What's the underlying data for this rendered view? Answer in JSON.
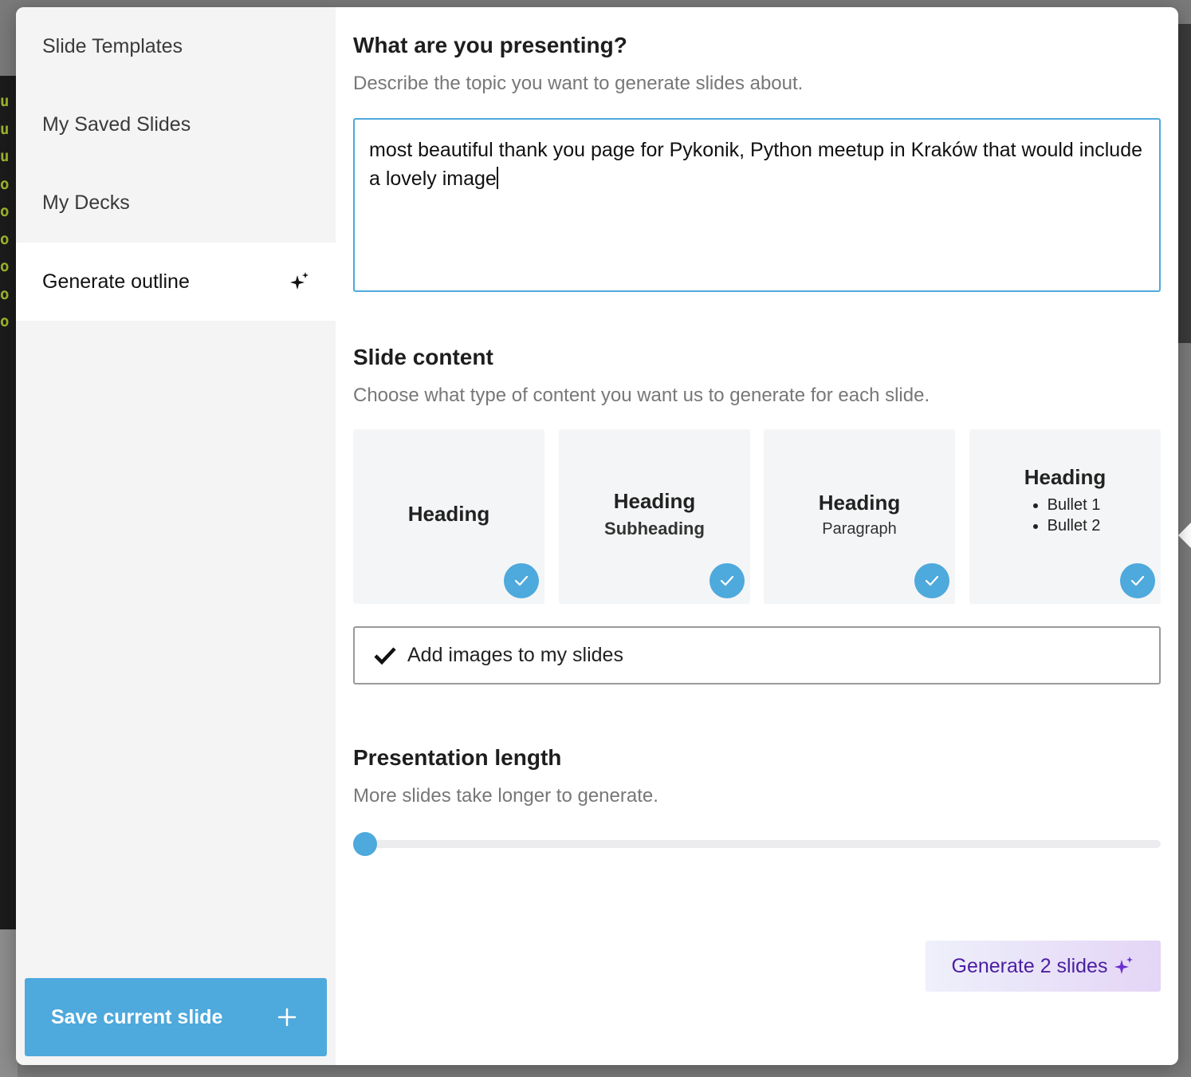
{
  "sidebar": {
    "items": [
      {
        "label": "Slide Templates"
      },
      {
        "label": "My Saved Slides"
      },
      {
        "label": "My Decks"
      },
      {
        "label": "Generate outline"
      }
    ],
    "save_button": "Save current slide"
  },
  "topic": {
    "title": "What are you presenting?",
    "description": "Describe the topic you want to generate slides about.",
    "value": "most beautiful thank you page for Pykonik, Python meetup in Kraków that would include a lovely image"
  },
  "content": {
    "title": "Slide content",
    "description": "Choose what type of content you want us to generate for each slide.",
    "cards": [
      {
        "heading": "Heading",
        "selected": true
      },
      {
        "heading": "Heading",
        "sub": "Subheading",
        "selected": true
      },
      {
        "heading": "Heading",
        "paragraph": "Paragraph",
        "selected": true
      },
      {
        "heading": "Heading",
        "bullets": [
          "Bullet 1",
          "Bullet 2"
        ],
        "selected": true
      }
    ],
    "images_toggle": "Add images to my slides",
    "images_enabled": true
  },
  "length": {
    "title": "Presentation length",
    "description": "More slides take longer to generate.",
    "slider_fraction": 0
  },
  "generate_button": "Generate 2 slides",
  "colors": {
    "accent": "#4ea9dc",
    "generate_text": "#4b1ea0"
  }
}
